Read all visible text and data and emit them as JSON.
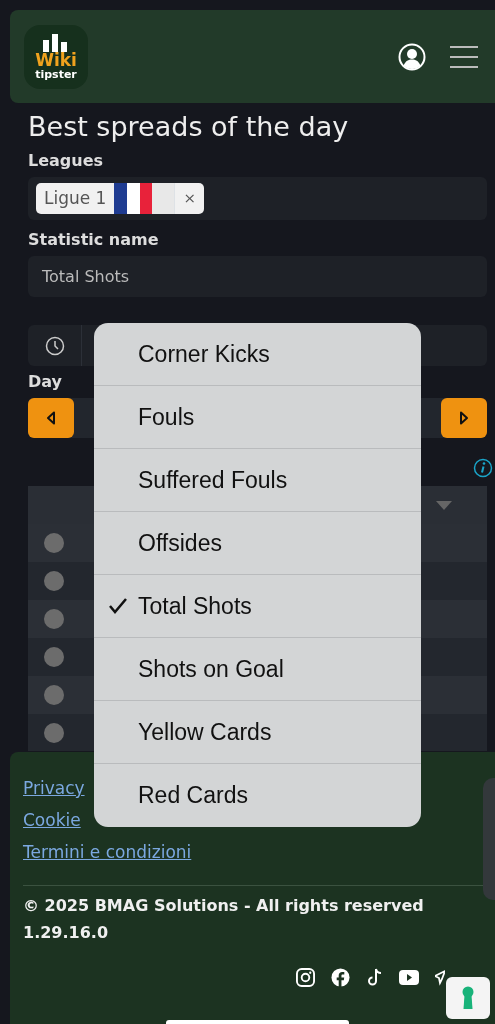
{
  "header": {
    "logo": {
      "line_1": "Wiki",
      "line_2": "tipster"
    }
  },
  "page_title": "Best spreads of the day",
  "leagues": {
    "label": "Leagues",
    "chips": [
      {
        "text": "Ligue 1",
        "remove": "×"
      }
    ]
  },
  "statistic": {
    "label": "Statistic name",
    "value": "Total Shots"
  },
  "day": {
    "label": "Day"
  },
  "table": {
    "rows": [
      {
        "selected": false
      },
      {
        "selected": false
      },
      {
        "selected": false
      },
      {
        "selected": false
      },
      {
        "selected": false
      },
      {
        "selected": false
      }
    ]
  },
  "dropdown": {
    "items": [
      {
        "label": "Corner Kicks",
        "selected": false
      },
      {
        "label": "Fouls",
        "selected": false
      },
      {
        "label": "Suffered Fouls",
        "selected": false
      },
      {
        "label": "Offsides",
        "selected": false
      },
      {
        "label": "Total Shots",
        "selected": true
      },
      {
        "label": "Shots on Goal",
        "selected": false
      },
      {
        "label": "Yellow Cards",
        "selected": false
      },
      {
        "label": "Red Cards",
        "selected": false
      }
    ]
  },
  "footer": {
    "links": [
      "Privacy",
      "Cookie",
      "Termini e condizioni"
    ],
    "copyright": "© 2025 BMAG Solutions - All rights reserved",
    "version": "1.29.16.0"
  }
}
